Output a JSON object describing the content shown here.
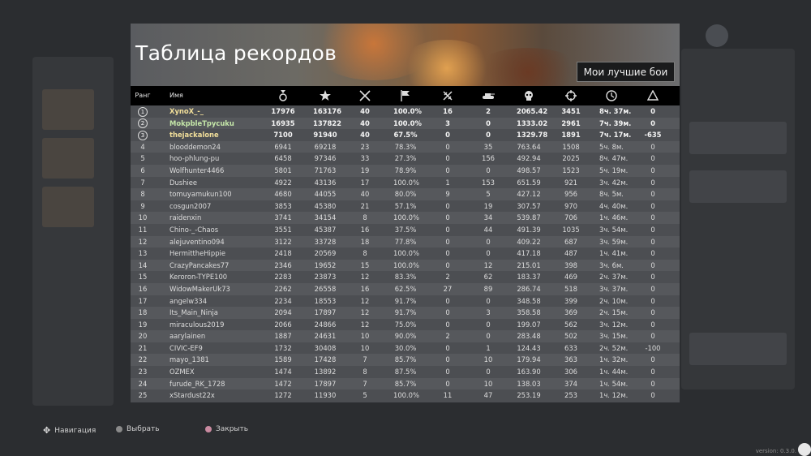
{
  "title": "Таблица рекордов",
  "best_battles_button": "Мои лучшие бои",
  "headers": {
    "rank": "Ранг",
    "name": "Имя"
  },
  "stat_icons": [
    "medal-icon",
    "star-icon",
    "crossed-swords-icon",
    "flag-icon",
    "crossed-planes-icon",
    "tank-icon",
    "skull-icon",
    "crosshair-icon",
    "clock-icon",
    "triangle-icon"
  ],
  "rows": [
    [
      "1",
      "XynoX_-_",
      "17976",
      "163176",
      "40",
      "100.0%",
      "16",
      "2",
      "2065.42",
      "3451",
      "8ч. 37м.",
      "0"
    ],
    [
      "2",
      "MokpbleTpycuku",
      "16935",
      "137822",
      "40",
      "100.0%",
      "3",
      "0",
      "1333.02",
      "2961",
      "7ч. 39м.",
      "0"
    ],
    [
      "3",
      "thejackalone",
      "7100",
      "91940",
      "40",
      "67.5%",
      "0",
      "0",
      "1329.78",
      "1891",
      "7ч. 17м.",
      "-635"
    ],
    [
      "4",
      "blooddemon24",
      "6941",
      "69218",
      "23",
      "78.3%",
      "0",
      "35",
      "763.64",
      "1508",
      "5ч. 8м.",
      "0"
    ],
    [
      "5",
      "hoo-phlung-pu",
      "6458",
      "97346",
      "33",
      "27.3%",
      "0",
      "156",
      "492.94",
      "2025",
      "8ч. 47м.",
      "0"
    ],
    [
      "6",
      "Wolfhunter4466",
      "5801",
      "71763",
      "19",
      "78.9%",
      "0",
      "0",
      "498.57",
      "1523",
      "5ч. 19м.",
      "0"
    ],
    [
      "7",
      "Dushiee",
      "4922",
      "43136",
      "17",
      "100.0%",
      "1",
      "153",
      "651.59",
      "921",
      "3ч. 42м.",
      "0"
    ],
    [
      "8",
      "tomuyamukun100",
      "4680",
      "44055",
      "40",
      "80.0%",
      "9",
      "5",
      "427.12",
      "956",
      "8ч. 5м.",
      "0"
    ],
    [
      "9",
      "cosgun2007",
      "3853",
      "45380",
      "21",
      "57.1%",
      "0",
      "19",
      "307.57",
      "970",
      "4ч. 40м.",
      "0"
    ],
    [
      "10",
      "raidenxin",
      "3741",
      "34154",
      "8",
      "100.0%",
      "0",
      "34",
      "539.87",
      "706",
      "1ч. 46м.",
      "0"
    ],
    [
      "11",
      "Chino-_-Chaos",
      "3551",
      "45387",
      "16",
      "37.5%",
      "0",
      "44",
      "491.39",
      "1035",
      "3ч. 54м.",
      "0"
    ],
    [
      "12",
      "alejuventino094",
      "3122",
      "33728",
      "18",
      "77.8%",
      "0",
      "0",
      "409.22",
      "687",
      "3ч. 59м.",
      "0"
    ],
    [
      "13",
      "HermittheHippie",
      "2418",
      "20569",
      "8",
      "100.0%",
      "0",
      "0",
      "417.18",
      "487",
      "1ч. 41м.",
      "0"
    ],
    [
      "14",
      "CrazyPancakes77",
      "2346",
      "19652",
      "15",
      "100.0%",
      "0",
      "12",
      "215.01",
      "398",
      "3ч. 6м.",
      "0"
    ],
    [
      "15",
      "Keroron-TYPE100",
      "2283",
      "23873",
      "12",
      "83.3%",
      "2",
      "62",
      "183.37",
      "469",
      "2ч. 37м.",
      "0"
    ],
    [
      "16",
      "WidowMakerUk73",
      "2262",
      "26558",
      "16",
      "62.5%",
      "27",
      "89",
      "286.74",
      "518",
      "3ч. 37м.",
      "0"
    ],
    [
      "17",
      "angelw334",
      "2234",
      "18553",
      "12",
      "91.7%",
      "0",
      "0",
      "348.58",
      "399",
      "2ч. 10м.",
      "0"
    ],
    [
      "18",
      "Its_Main_Ninja",
      "2094",
      "17897",
      "12",
      "91.7%",
      "0",
      "3",
      "358.58",
      "369",
      "2ч. 15м.",
      "0"
    ],
    [
      "19",
      "miraculous2019",
      "2066",
      "24866",
      "12",
      "75.0%",
      "0",
      "0",
      "199.07",
      "562",
      "3ч. 12м.",
      "0"
    ],
    [
      "20",
      "aarylainen",
      "1887",
      "24631",
      "10",
      "90.0%",
      "2",
      "0",
      "283.48",
      "502",
      "3ч. 15м.",
      "0"
    ],
    [
      "21",
      "CIVIC-EF9",
      "1732",
      "30408",
      "10",
      "30.0%",
      "0",
      "1",
      "124.43",
      "633",
      "2ч. 52м.",
      "-100"
    ],
    [
      "22",
      "mayo_1381",
      "1589",
      "17428",
      "7",
      "85.7%",
      "0",
      "10",
      "179.94",
      "363",
      "1ч. 32м.",
      "0"
    ],
    [
      "23",
      "OZMEX",
      "1474",
      "13892",
      "8",
      "87.5%",
      "0",
      "0",
      "163.90",
      "306",
      "1ч. 44м.",
      "0"
    ],
    [
      "24",
      "furude_RK_1728",
      "1472",
      "17897",
      "7",
      "85.7%",
      "0",
      "10",
      "138.03",
      "374",
      "1ч. 54м.",
      "0"
    ],
    [
      "25",
      "xStardust22x",
      "1272",
      "11930",
      "5",
      "100.0%",
      "11",
      "47",
      "253.19",
      "253",
      "1ч. 12м.",
      "0"
    ]
  ],
  "footer": {
    "navigate": "Навигация",
    "select": "Выбрать",
    "close": "Закрыть"
  },
  "version": "version: 0.3.0."
}
